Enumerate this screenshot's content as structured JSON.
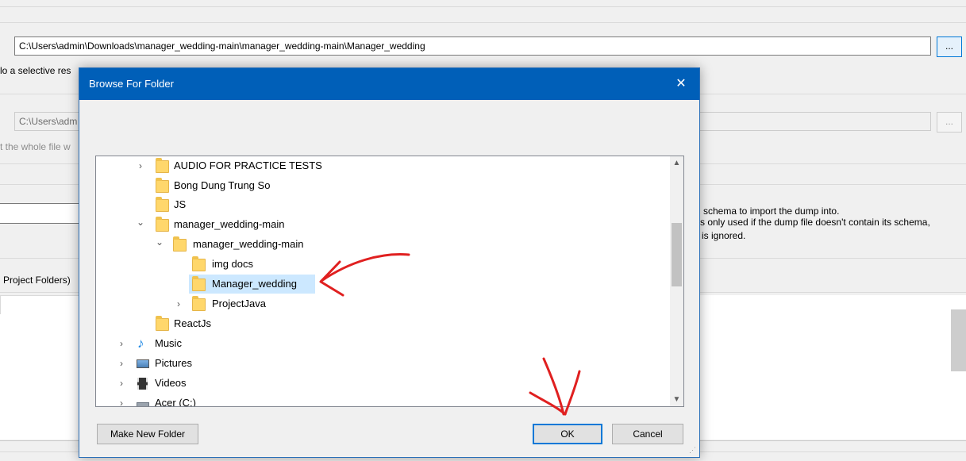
{
  "background": {
    "path_value": "C:\\Users\\admin\\Downloads\\manager_wedding-main\\manager_wedding-main\\Manager_wedding",
    "browse_label": "...",
    "selective_text": "lo a selective res",
    "disabled_path": "C:\\Users\\adm",
    "disabled_browse_label": "...",
    "whole_file_text": "t the whole file w",
    "schema_note_1": "schema to import the dump into.",
    "schema_note_2": "s only used if the dump file doesn't contain its schema,",
    "schema_note_3": "is ignored.",
    "project_folders_label": "Project Folders)"
  },
  "dialog": {
    "title": "Browse For Folder",
    "close_symbol": "✕",
    "tree": [
      {
        "label": "AUDIO FOR PRACTICE TESTS",
        "icon": "folder-icon",
        "chevron": "›"
      },
      {
        "label": "Bong Dung Trung So",
        "icon": "folder-icon",
        "chevron": ""
      },
      {
        "label": "JS",
        "icon": "folder-icon",
        "chevron": ""
      },
      {
        "label": "manager_wedding-main",
        "icon": "folder-icon",
        "chevron": "⌄"
      },
      {
        "label": "manager_wedding-main",
        "icon": "folder-icon",
        "chevron": "⌄"
      },
      {
        "label": "img docs",
        "icon": "folder-icon",
        "chevron": ""
      },
      {
        "label": "Manager_wedding",
        "icon": "folder-icon",
        "chevron": "",
        "selected": true
      },
      {
        "label": "ProjectJava",
        "icon": "folder-icon",
        "chevron": "›"
      },
      {
        "label": "ReactJs",
        "icon": "folder-icon",
        "chevron": ""
      },
      {
        "label": "Music",
        "icon": "music-icon",
        "chevron": "›"
      },
      {
        "label": "Pictures",
        "icon": "pictures-icon",
        "chevron": "›"
      },
      {
        "label": "Videos",
        "icon": "videos-icon",
        "chevron": "›"
      },
      {
        "label": "Acer (C:)",
        "icon": "drive-icon",
        "chevron": "›"
      }
    ],
    "make_new_folder_label": "Make New Folder",
    "ok_label": "OK",
    "cancel_label": "Cancel"
  },
  "colors": {
    "titlebar": "#005fb8",
    "selection": "#cce8ff",
    "annotation": "#e02020"
  }
}
